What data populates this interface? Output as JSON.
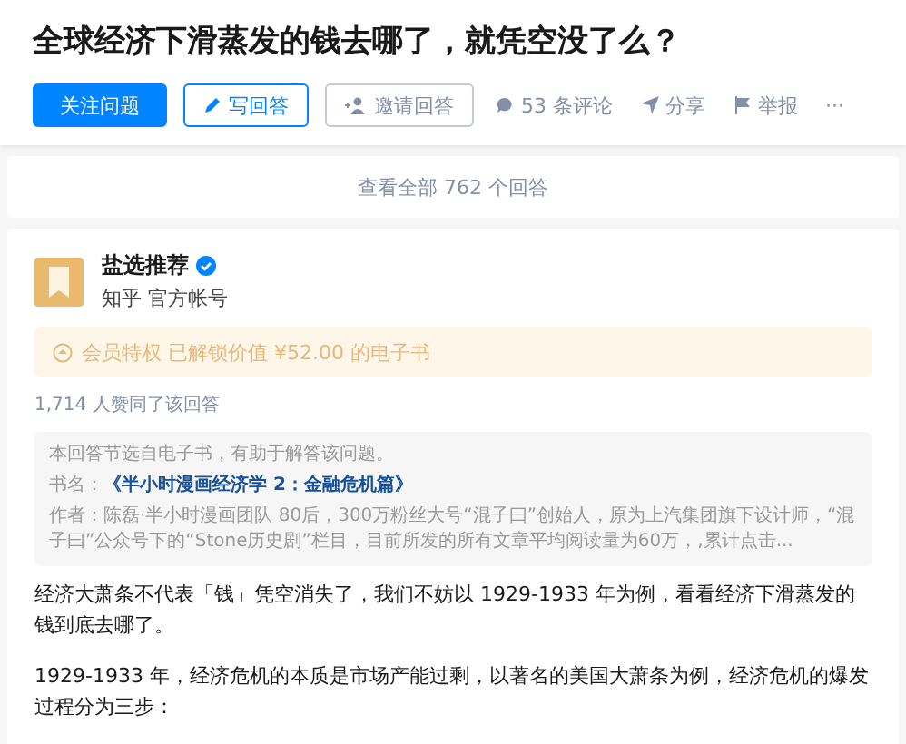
{
  "question": {
    "title": "全球经济下滑蒸发的钱去哪了，就凭空没了么？",
    "actions": [
      {
        "kind": "primary",
        "label": "关注问题"
      },
      {
        "kind": "outline",
        "label": "写回答"
      },
      {
        "kind": "outline-gray",
        "label": "邀请回答"
      },
      {
        "kind": "text",
        "label": "53 条评论"
      },
      {
        "kind": "text",
        "label": "分享"
      },
      {
        "kind": "text",
        "label": "举报"
      },
      {
        "kind": "more",
        "label": "···"
      }
    ]
  },
  "view_all": "查看全部 762 个回答",
  "answer": {
    "author": {
      "name": "盐选推荐",
      "verified": true,
      "subtitle": "知乎 官方帐号"
    },
    "member_banner": "会员特权 已解锁价值 ¥52.00 的电子书",
    "votes": "1,714 人赞同了该回答",
    "excerpt": {
      "note": "本回答节选自电子书，有助于解答该问题。",
      "book_label": "书名：",
      "book_title": "《半小时漫画经济学 2：金融危机篇》",
      "author_label": "作者：",
      "author_text": "陈磊·半小时漫画团队 80后，300万粉丝大号“混子曰”创始人，原为上汽集团旗下设计师，“混子曰”公众号下的“Stone历史剧”栏目，目前所发的所有文章平均阅读量为60万，,累计点击..."
    },
    "paragraphs": [
      "经济大萧条不代表「钱」凭空消失了，我们不妨以 1929-1933 年为例，看看经济下滑蒸发的钱到底去哪了。",
      "1929-1933 年，经济危机的本质是市场产能过剩，以著名的美国大萧条为例，经济危机的爆发过程分为三步："
    ]
  }
}
